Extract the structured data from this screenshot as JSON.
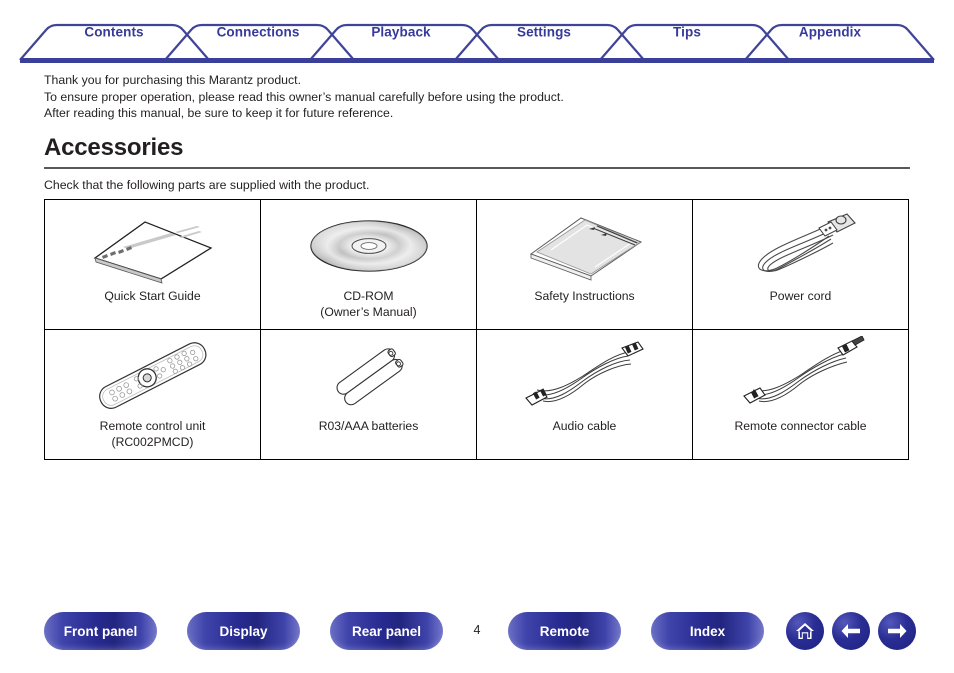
{
  "tabs": [
    {
      "label": "Contents",
      "name": "tab-contents"
    },
    {
      "label": "Connections",
      "name": "tab-connections"
    },
    {
      "label": "Playback",
      "name": "tab-playback"
    },
    {
      "label": "Settings",
      "name": "tab-settings"
    },
    {
      "label": "Tips",
      "name": "tab-tips"
    },
    {
      "label": "Appendix",
      "name": "tab-appendix"
    }
  ],
  "intro": {
    "line1": "Thank you for purchasing this Marantz product.",
    "line2": "To ensure proper operation, please read this owner’s manual carefully before using the product.",
    "line3": "After reading this manual, be sure to keep it for future reference."
  },
  "section": {
    "heading": "Accessories",
    "subtext": "Check that the following parts are supplied with the product."
  },
  "accessories": [
    {
      "label": "Quick Start Guide",
      "sub": "",
      "art": "booklet"
    },
    {
      "label": "CD-ROM",
      "sub": "(Owner’s Manual)",
      "art": "cd-rom"
    },
    {
      "label": "Safety Instructions",
      "sub": "",
      "art": "sheets"
    },
    {
      "label": "Power cord",
      "sub": "",
      "art": "power-cord"
    },
    {
      "label": "Remote control unit",
      "sub": "(RC002PMCD)",
      "art": "remote"
    },
    {
      "label": "R03/AAA batteries",
      "sub": "",
      "art": "batteries"
    },
    {
      "label": "Audio cable",
      "sub": "",
      "art": "audio-cable"
    },
    {
      "label": "Remote connector cable",
      "sub": "",
      "art": "connector-cable"
    }
  ],
  "bottom_nav": {
    "buttons": [
      {
        "label": "Front panel",
        "name": "front-panel-button"
      },
      {
        "label": "Display",
        "name": "display-button"
      },
      {
        "label": "Rear panel",
        "name": "rear-panel-button"
      },
      {
        "label": "Remote",
        "name": "remote-button"
      },
      {
        "label": "Index",
        "name": "index-button"
      }
    ],
    "page_number": "4",
    "icons": [
      {
        "name": "home-icon"
      },
      {
        "name": "arrow-left-icon"
      },
      {
        "name": "arrow-right-icon"
      }
    ]
  },
  "colors": {
    "brand_blue": "#363a9a",
    "rule_gray": "#58595b",
    "text": "#231f20"
  }
}
